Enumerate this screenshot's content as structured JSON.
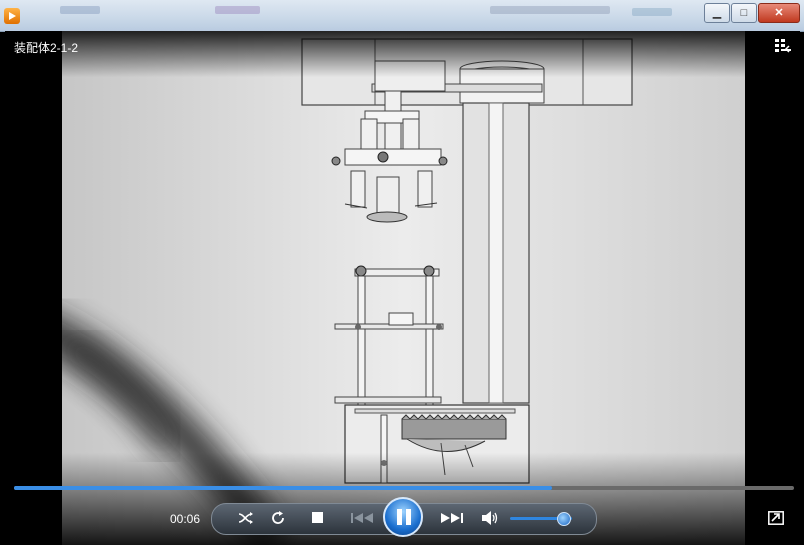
{
  "window": {
    "minimize_label": "▁",
    "maximize_label": "□",
    "close_label": "✕"
  },
  "player": {
    "title": "装配体2-1-2",
    "time": "00:06",
    "progress": 0.69,
    "volume": 0.85
  }
}
